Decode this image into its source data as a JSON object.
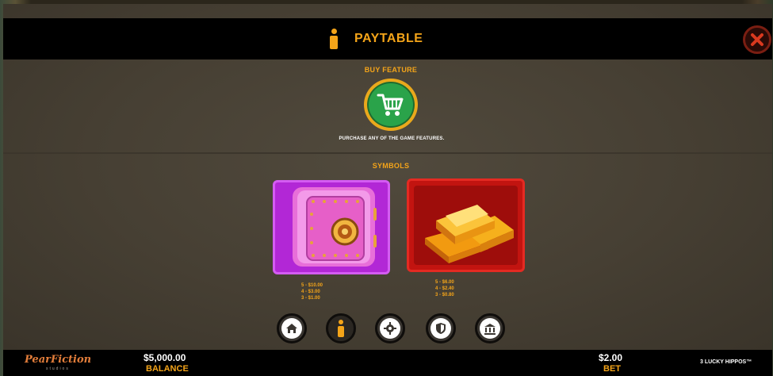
{
  "header": {
    "title": "PAYTABLE"
  },
  "buy_feature": {
    "heading": "BUY FEATURE",
    "description": "PURCHASE ANY OF THE GAME FEATURES."
  },
  "symbols": {
    "heading": "SYMBOLS",
    "items": [
      {
        "name": "safe",
        "payouts": [
          "5 - $10.00",
          "4 - $3.00",
          "3 - $1.00"
        ]
      },
      {
        "name": "gold-bars",
        "payouts": [
          "5 - $6.00",
          "4 - $2.40",
          "3 - $0.80"
        ]
      }
    ]
  },
  "nav": [
    "home-icon",
    "info-icon",
    "gear-icon",
    "shield-icon",
    "bank-icon"
  ],
  "footer": {
    "logo": "PearFiction",
    "logo_sub": "studios",
    "balance_value": "$5,000.00",
    "balance_label": "BALANCE",
    "bet_value": "$2.00",
    "bet_label": "BET",
    "game_name": "3 LUCKY HIPPOS™"
  },
  "colors": {
    "accent": "#f4a419",
    "cart_green": "#2aa34a",
    "close_red": "#c0392b"
  }
}
